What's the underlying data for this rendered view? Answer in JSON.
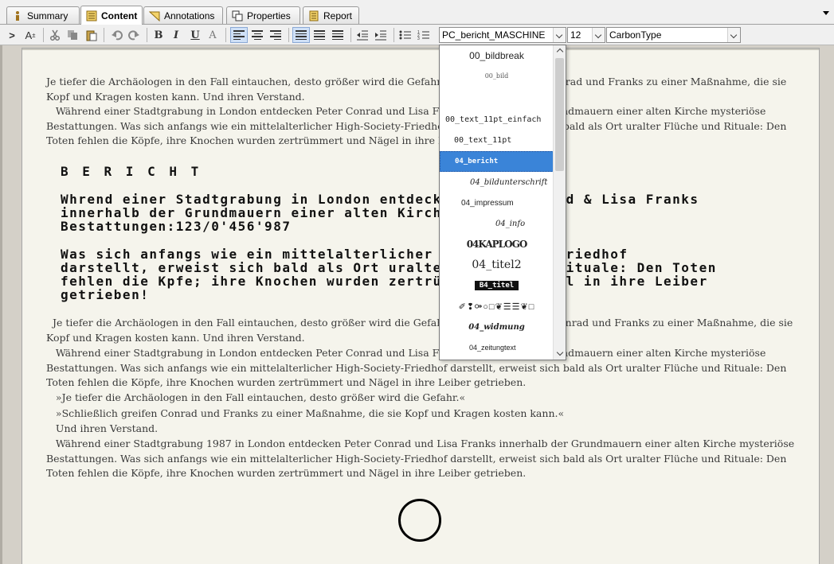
{
  "tabs": [
    {
      "label": "Summary",
      "icon": "info-icon"
    },
    {
      "label": "Content",
      "icon": "content-icon",
      "active": true
    },
    {
      "label": "Annotations",
      "icon": "annotation-icon"
    },
    {
      "label": "Properties",
      "icon": "properties-icon"
    },
    {
      "label": "Report",
      "icon": "report-icon"
    }
  ],
  "toolbar": {
    "bold": "B",
    "italic": "I",
    "underline": "U",
    "text_color": "A",
    "style_value": "PC_bericht_MASCHINE",
    "size_value": "12",
    "font_value": "CarbonType"
  },
  "document": {
    "p1": "Je tiefer die Archäologen in den Fall eintauchen, desto größer wird die Gefahr. Schließlich greifen Conrad und Franks zu einer Maßnahme, die sie Kopf und Kragen kosten kann. Und ihren Verstand.",
    "p2": "   Während einer Stadtgrabung in London entdecken Peter Conrad und Lisa Franks innerhalb der Grundmauern einer alten Kirche mysteriöse Bestattungen. Was sich anfangs wie ein mittelalterlicher High-Society-Friedhof darstellt, erweist sich bald als Ort uralter Flüche und Rituale: Den Toten fehlen die Köpfe, ihre Knochen wurden zertrümmert und Nägel in ihre Leiber getrieben.",
    "typed_heading": "B E R I C H T",
    "typed_1": "Whrend einer Stadtgrabung in London entdecken Peter Conrad & Lisa Franks\ninnerhalb der Grundmauern einer alten Kirche mysteriöse\nBestattungen:123/0'456'987",
    "typed_2": "Was sich anfangs wie ein mittelalterlicher High-Society-Friedhof\ndarstellt, erweist sich bald als Ort uralter Flüche und Rituale: Den Toten\nfehlen die Kpfe; ihre Knochen wurden zertrümmert und Nägel in ihre Leiber\ngetrieben!",
    "p3": "  Je tiefer die Archäologen in den Fall eintauchen, desto größer wird die Gefahr. Schließlich greifen Conrad und Franks zu einer Maßnahme, die sie Kopf und Kragen kosten kann. Und ihren Verstand.",
    "p4": "   Während einer Stadtgrabung in London entdecken Peter Conrad und Lisa Franks innerhalb der Grundmauern einer alten Kirche mysteriöse Bestattungen. Was sich anfangs wie ein mittelalterlicher High-Society-Friedhof darstellt, erweist sich bald als Ort uralter Flüche und Rituale: Den Toten fehlen die Köpfe, ihre Knochen wurden zertrümmert und Nägel in ihre Leiber getrieben.",
    "q1": "   »Je tiefer die Archäologen in den Fall eintauchen, desto größer wird die Gefahr.«",
    "q2": "   »Schließlich greifen Conrad und Franks zu einer Maßnahme, die sie Kopf und Kragen kosten kann.«",
    "p5": "   Und ihren Verstand.",
    "p6": "   Während einer Stadtgrabung 1987 in London entdecken Peter Conrad und Lisa Franks innerhalb der Grundmauern einer alten Kirche mysteriöse Bestattungen. Was sich anfangs wie ein mittelalterlicher High-Society-Friedhof darstellt, erweist sich bald als Ort uralter Flüche und Rituale: Den Toten fehlen die Köpfe, ihre Knochen wurden zertrümmert und Nägel in ihre Leiber getrieben."
  },
  "style_dropdown": {
    "items": [
      {
        "label": "00_bildbreak"
      },
      {
        "label": "00_bild"
      },
      {
        "label": ""
      },
      {
        "label": "00_text_11pt_einfach"
      },
      {
        "label": "00_text_11pt"
      },
      {
        "label": "04_bericht",
        "selected": true
      },
      {
        "label": "04_bildunterschrift"
      },
      {
        "label": "04_impressum"
      },
      {
        "label": "04_info"
      },
      {
        "label": "04KAPLOGO"
      },
      {
        "label": "04_titel2"
      },
      {
        "label": "B4_titel"
      },
      {
        "label": "✐❢⚩○□❦☰☰❦□"
      },
      {
        "label": "04_widmung"
      },
      {
        "label": "04_zeitungtext"
      }
    ]
  }
}
